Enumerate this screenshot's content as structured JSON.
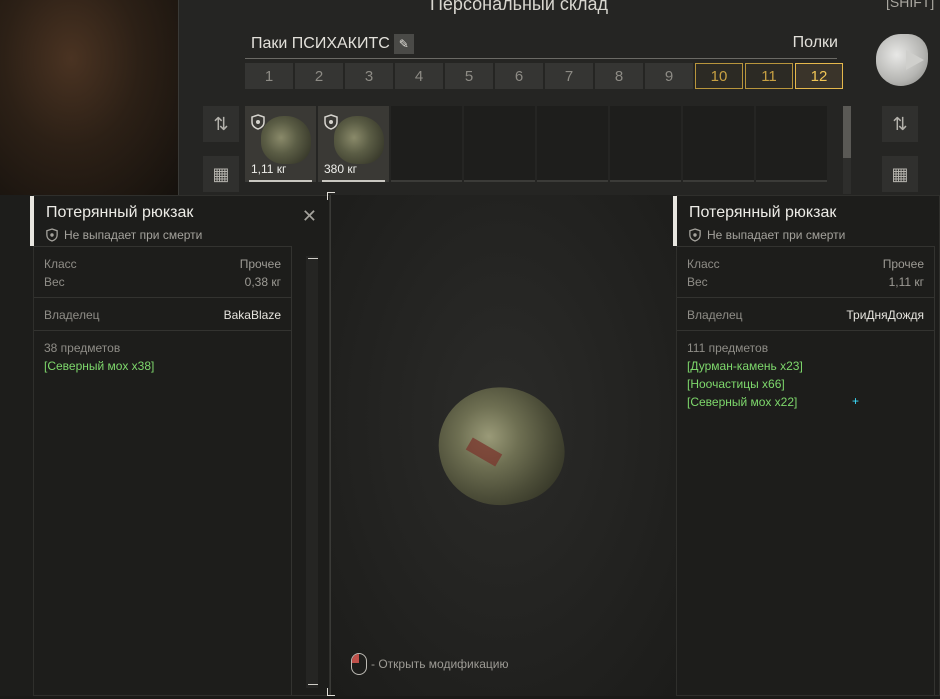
{
  "warehouse": {
    "title": "Персональный склад",
    "pack_name": "Паки ПСИХАКИТС",
    "shelves_label": "Полки",
    "tabs": [
      "1",
      "2",
      "3",
      "4",
      "5",
      "6",
      "7",
      "8",
      "9",
      "10",
      "11",
      "12"
    ],
    "slots": [
      {
        "weight": "1,11 кг"
      },
      {
        "weight": "380 кг"
      }
    ]
  },
  "right_panel": {
    "shift_hint": "[SHIFT]"
  },
  "left_card": {
    "title": "Потерянный рюкзак",
    "subtitle": "Не выпадает при смерти",
    "class_label": "Класс",
    "class_value": "Прочее",
    "weight_label": "Вес",
    "weight_value": "0,38 кг",
    "owner_label": "Владелец",
    "owner_value": "BakaBlaze",
    "items_count": "38 предметов",
    "items": [
      "[Северный мох x38]"
    ]
  },
  "right_card": {
    "title": "Потерянный рюкзак",
    "subtitle": "Не выпадает при смерти",
    "class_label": "Класс",
    "class_value": "Прочее",
    "weight_label": "Вес",
    "weight_value": "1,11 кг",
    "owner_label": "Владелец",
    "owner_value": "ТриДняДождя",
    "items_count": "111 предметов",
    "items": [
      "[Дурман-камень x23]",
      "[Ноочастицы x66]",
      "[Северный мох x22]"
    ]
  },
  "viewer": {
    "hint": "- Открыть модификацию"
  },
  "colors": {
    "item_green": "#7ed86c",
    "tab_gold": "#c7a043",
    "tab_active": "#f0c556"
  }
}
